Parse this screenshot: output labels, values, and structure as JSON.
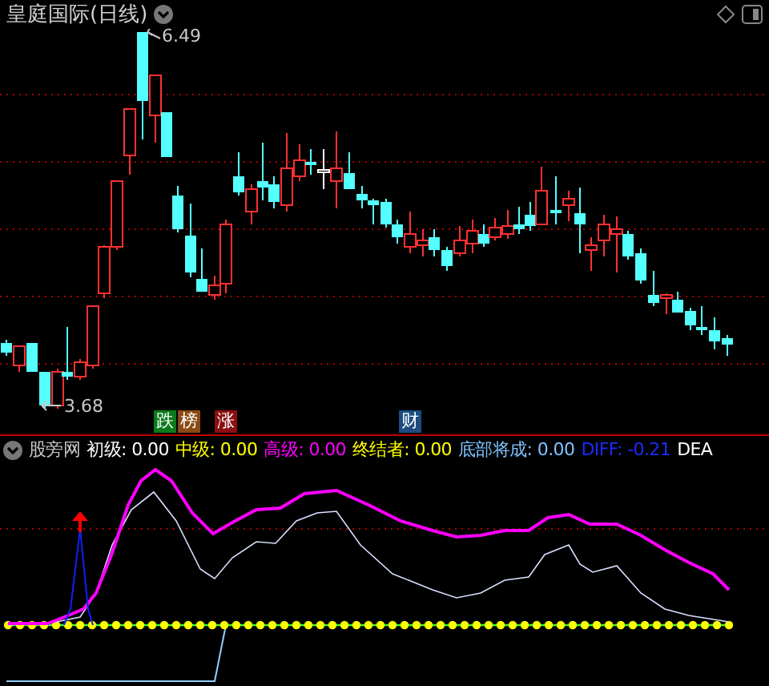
{
  "title": "皇庭国际(日线)",
  "price_chart": {
    "high_label": "6.49",
    "low_label": "3.68"
  },
  "events": [
    {
      "label": "跌",
      "color": "#0b7a1c"
    },
    {
      "label": "榜",
      "color": "#8a4a12"
    },
    {
      "label": "涨",
      "color": "#8a0f0f"
    },
    {
      "label": "财",
      "color": "#1c4c80"
    }
  ],
  "indicator": {
    "name": "股旁网",
    "values": [
      {
        "text": "初级: 0.00",
        "color": "#ffffff"
      },
      {
        "text": "中级: 0.00",
        "color": "#ffff00"
      },
      {
        "text": "高级: 0.00",
        "color": "#ff00ff"
      },
      {
        "text": "终结者: 0.00",
        "color": "#ffff00"
      },
      {
        "text": "底部将成: 0.00",
        "color": "#7fc4ff"
      },
      {
        "text": "DIFF: -0.21",
        "color": "#1a2cff"
      },
      {
        "text": "DEA",
        "color": "#ffffff"
      }
    ]
  }
}
